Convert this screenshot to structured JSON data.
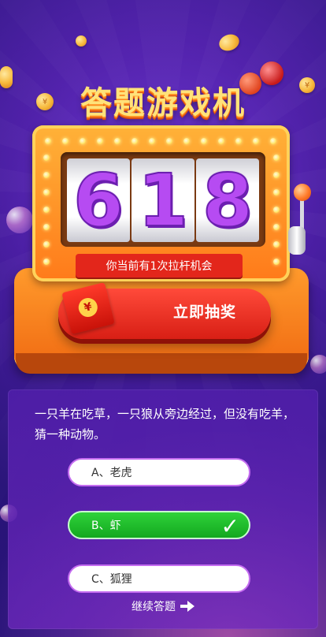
{
  "header": {
    "title": "答题游戏机"
  },
  "slot_machine": {
    "reels": [
      "6",
      "1",
      "8"
    ],
    "chance_text": "你当前有1次拉杆机会",
    "draw_button_label": "立即抽奖",
    "envelope_symbol": "¥",
    "coin_symbol": "¥"
  },
  "quiz": {
    "question": "一只羊在吃草，一只狼从旁边经过，但没有吃羊，猜一种动物。",
    "options": [
      {
        "label": "A、老虎",
        "state": "default"
      },
      {
        "label": "B、虾",
        "state": "correct"
      },
      {
        "label": "C、狐狸",
        "state": "default"
      }
    ],
    "correct_mark": "✓",
    "continue_label": "继续答题"
  },
  "colors": {
    "background": "#3b1a8c",
    "machine_orange": "#ff7a1a",
    "reel_digit": "#b64bf2",
    "chance_bar": "#e3261b",
    "draw_button": "#d81f15",
    "correct_green": "#13a81f",
    "option_border": "#c56df0"
  }
}
